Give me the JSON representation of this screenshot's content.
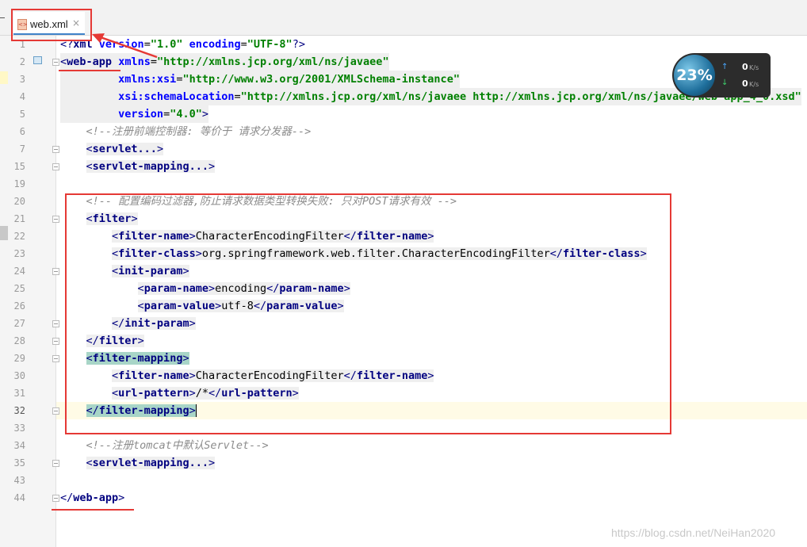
{
  "tab": {
    "label": "web.xml",
    "close": "×",
    "icon": "xml-file-icon"
  },
  "widget": {
    "percent": "23%",
    "upload": {
      "arrow": "↑",
      "value": "0",
      "unit": "K/s"
    },
    "download": {
      "arrow": "↓",
      "value": "0",
      "unit": "K/s"
    }
  },
  "watermark": "https://blog.csdn.net/NeiHan2020",
  "current_line": "32",
  "lines": [
    {
      "n": "1"
    },
    {
      "n": "2"
    },
    {
      "n": "3"
    },
    {
      "n": "4"
    },
    {
      "n": "5"
    },
    {
      "n": "6"
    },
    {
      "n": "7"
    },
    {
      "n": "15"
    },
    {
      "n": "19"
    },
    {
      "n": "20"
    },
    {
      "n": "21"
    },
    {
      "n": "22"
    },
    {
      "n": "23"
    },
    {
      "n": "24"
    },
    {
      "n": "25"
    },
    {
      "n": "26"
    },
    {
      "n": "27"
    },
    {
      "n": "28"
    },
    {
      "n": "29"
    },
    {
      "n": "30"
    },
    {
      "n": "31"
    },
    {
      "n": "32"
    },
    {
      "n": "33"
    },
    {
      "n": "34"
    },
    {
      "n": "35"
    },
    {
      "n": "43"
    },
    {
      "n": "44"
    }
  ],
  "code": {
    "l1_open": "<?",
    "l1_xml": "xml ",
    "l1_version_attr": "version",
    "l1_version_val": "\"1.0\"",
    "l1_encoding_attr": "encoding",
    "l1_encoding_val": "\"UTF-8\"",
    "l1_close": "?>",
    "web_app": "web-app",
    "xmlns_attr": "xmlns",
    "xmlns_val": "\"http://xmlns.jcp.org/xml/ns/javaee\"",
    "xsi_attr": "xmlns:xsi",
    "xsi_val": "\"http://www.w3.org/2001/XMLSchema-instance\"",
    "schema_attr": "xsi:schemaLocation",
    "schema_val": "\"http://xmlns.jcp.org/xml/ns/javaee http://xmlns.jcp.org/xml/ns/javaee/web-app_4_0.xsd\"",
    "version_attr": "version",
    "version_val": "\"4.0\"",
    "comment1": "<!--注册前端控制器: 等价于 请求分发器-->",
    "servlet_folded": "servlet...",
    "servlet_mapping_folded": "servlet-mapping...",
    "comment2": "<!-- 配置编码过滤器,防止请求数据类型转换失败: 只对POST请求有效 -->",
    "filter": "filter",
    "filter_name": "filter-name",
    "filter_name_val": "CharacterEncodingFilter",
    "filter_class": "filter-class",
    "filter_class_val": "org.springframework.web.filter.CharacterEncodingFilter",
    "init_param": "init-param",
    "param_name": "param-name",
    "param_name_val": "encoding",
    "param_value": "param-value",
    "param_value_val": "utf-8",
    "filter_mapping": "filter-mapping",
    "url_pattern": "url-pattern",
    "url_pattern_val": "/*",
    "comment3": "<!--注册tomcat中默认Servlet-->",
    "servlet_mapping_folded2": "servlet-mapping..."
  }
}
